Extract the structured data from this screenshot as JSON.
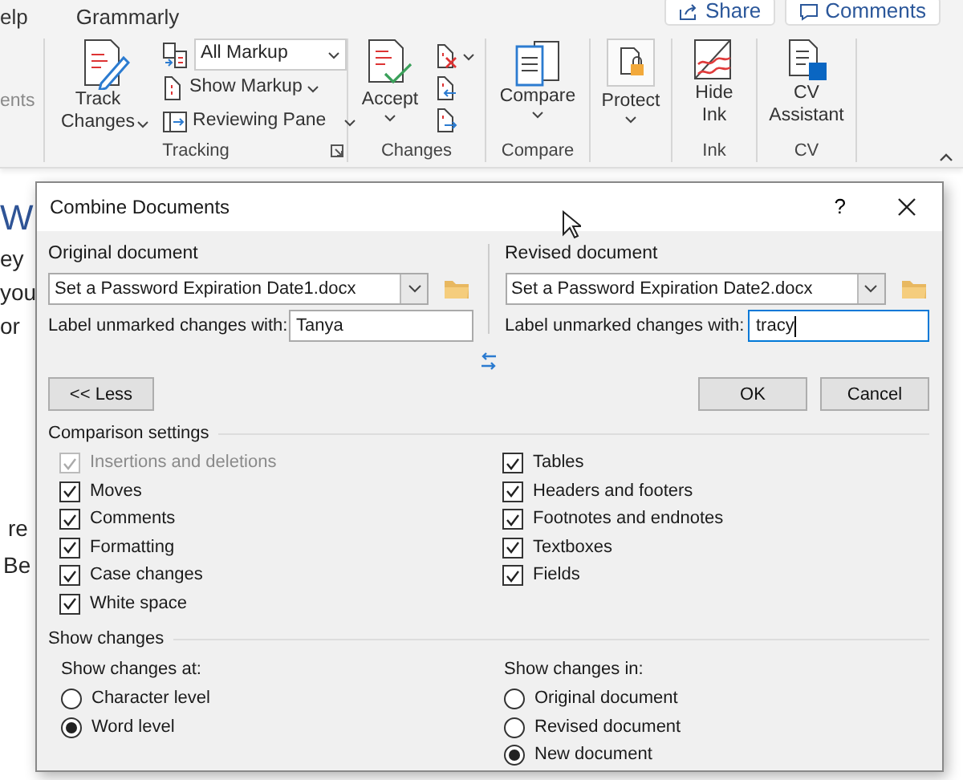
{
  "ribbon": {
    "tabs": [
      {
        "label": "elp"
      },
      {
        "label": "Grammarly"
      }
    ],
    "share": "Share",
    "comments": "Comments",
    "partial_command": {
      "label": "ents",
      "disabled": true
    },
    "tracking": {
      "label": "Tracking",
      "track_changes": "Track Changes",
      "markup_dropdown": {
        "value": "All Markup"
      },
      "show_markup": "Show Markup",
      "reviewing_pane": "Reviewing Pane"
    },
    "changes": {
      "label": "Changes",
      "accept": "Accept"
    },
    "compare": {
      "label": "Compare",
      "compare": "Compare"
    },
    "protect": {
      "protect": "Protect"
    },
    "ink": {
      "label": "Ink",
      "hide_ink": "Hide Ink"
    },
    "cv": {
      "label": "CV",
      "cv_assistant": "CV Assistant"
    }
  },
  "document": {
    "heading": "W",
    "lines": [
      "ey",
      "you",
      "or"
    ],
    "lower_lines": [
      "re",
      "Be"
    ]
  },
  "dialog": {
    "title": "Combine Documents",
    "help": "?",
    "original": {
      "label": "Original document",
      "file": "Set a Password Expiration Date1.docx",
      "prompt": "Label unmarked changes with:",
      "value": "Tanya",
      "focused": false
    },
    "revised": {
      "label": "Revised document",
      "file": "Set a Password Expiration Date2.docx",
      "prompt": "Label unmarked changes with:",
      "value": "tracy",
      "focused": true
    },
    "less_button": "<< Less",
    "ok_button": "OK",
    "cancel_button": "Cancel",
    "comparison_settings": {
      "heading": "Comparison settings",
      "left": [
        {
          "label": "Insertions and deletions",
          "checked": true,
          "disabled": true
        },
        {
          "label": "Moves",
          "checked": true,
          "disabled": false
        },
        {
          "label": "Comments",
          "checked": true,
          "disabled": false
        },
        {
          "label": "Formatting",
          "checked": true,
          "disabled": false
        },
        {
          "label": "Case changes",
          "checked": true,
          "disabled": false
        },
        {
          "label": "White space",
          "checked": true,
          "disabled": false
        }
      ],
      "right": [
        {
          "label": "Tables",
          "checked": true,
          "disabled": false
        },
        {
          "label": "Headers and footers",
          "checked": true,
          "disabled": false
        },
        {
          "label": "Footnotes and endnotes",
          "checked": true,
          "disabled": false
        },
        {
          "label": "Textboxes",
          "checked": true,
          "disabled": false
        },
        {
          "label": "Fields",
          "checked": true,
          "disabled": false
        }
      ]
    },
    "show_changes": {
      "heading": "Show changes",
      "at": {
        "label": "Show changes at:",
        "options": [
          {
            "label": "Character level",
            "selected": false
          },
          {
            "label": "Word level",
            "selected": true
          }
        ]
      },
      "in": {
        "label": "Show changes in:",
        "options": [
          {
            "label": "Original document",
            "selected": false
          },
          {
            "label": "Revised document",
            "selected": false
          },
          {
            "label": "New document",
            "selected": true
          }
        ]
      }
    }
  }
}
